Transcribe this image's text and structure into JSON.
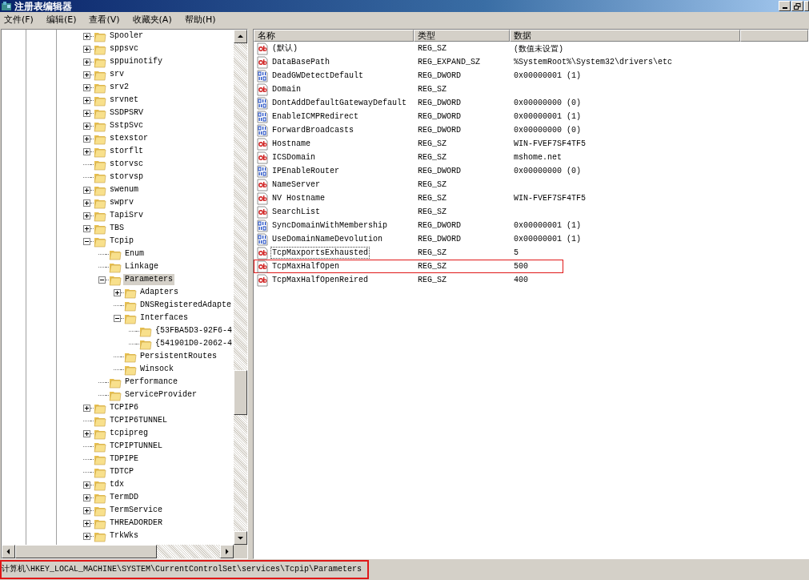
{
  "window": {
    "title": "注册表编辑器"
  },
  "menu": [
    "文件(F)",
    "编辑(E)",
    "查看(V)",
    "收藏夹(A)",
    "帮助(H)"
  ],
  "tree": [
    {
      "label": "Spooler",
      "expandable": true,
      "expanded": false,
      "selected": false
    },
    {
      "label": "sppsvc",
      "expandable": true,
      "expanded": false,
      "selected": false
    },
    {
      "label": "sppuinotify",
      "expandable": true,
      "expanded": false,
      "selected": false
    },
    {
      "label": "srv",
      "expandable": true,
      "expanded": false,
      "selected": false
    },
    {
      "label": "srv2",
      "expandable": true,
      "expanded": false,
      "selected": false
    },
    {
      "label": "srvnet",
      "expandable": true,
      "expanded": false,
      "selected": false
    },
    {
      "label": "SSDPSRV",
      "expandable": true,
      "expanded": false,
      "selected": false
    },
    {
      "label": "SstpSvc",
      "expandable": true,
      "expanded": false,
      "selected": false
    },
    {
      "label": "stexstor",
      "expandable": true,
      "expanded": false,
      "selected": false
    },
    {
      "label": "storflt",
      "expandable": true,
      "expanded": false,
      "selected": false
    },
    {
      "label": "storvsc",
      "expandable": false,
      "selected": false
    },
    {
      "label": "storvsp",
      "expandable": false,
      "selected": false
    },
    {
      "label": "swenum",
      "expandable": true,
      "expanded": false,
      "selected": false
    },
    {
      "label": "swprv",
      "expandable": true,
      "expanded": false,
      "selected": false
    },
    {
      "label": "TapiSrv",
      "expandable": true,
      "expanded": false,
      "selected": false
    },
    {
      "label": "TBS",
      "expandable": true,
      "expanded": false,
      "selected": false
    },
    {
      "label": "Tcpip",
      "expandable": true,
      "expanded": true,
      "selected": false,
      "children": [
        {
          "label": "Enum",
          "expandable": false,
          "selected": false
        },
        {
          "label": "Linkage",
          "expandable": false,
          "selected": false
        },
        {
          "label": "Parameters",
          "expandable": true,
          "expanded": true,
          "selected": true,
          "children": [
            {
              "label": "Adapters",
              "expandable": true,
              "expanded": false,
              "selected": false
            },
            {
              "label": "DNSRegisteredAdapte",
              "expandable": false,
              "selected": false
            },
            {
              "label": "Interfaces",
              "expandable": true,
              "expanded": true,
              "selected": false,
              "children": [
                {
                  "label": "{53FBA5D3-92F6-4",
                  "expandable": false,
                  "selected": false
                },
                {
                  "label": "{541901D0-2062-4",
                  "expandable": false,
                  "selected": false
                }
              ]
            },
            {
              "label": "PersistentRoutes",
              "expandable": false,
              "selected": false
            },
            {
              "label": "Winsock",
              "expandable": false,
              "selected": false
            }
          ]
        },
        {
          "label": "Performance",
          "expandable": false,
          "selected": false
        },
        {
          "label": "ServiceProvider",
          "expandable": false,
          "selected": false
        }
      ]
    },
    {
      "label": "TCPIP6",
      "expandable": true,
      "expanded": false,
      "selected": false
    },
    {
      "label": "TCPIP6TUNNEL",
      "expandable": false,
      "selected": false
    },
    {
      "label": "tcpipreg",
      "expandable": true,
      "expanded": false,
      "selected": false
    },
    {
      "label": "TCPIPTUNNEL",
      "expandable": false,
      "selected": false
    },
    {
      "label": "TDPIPE",
      "expandable": false,
      "selected": false
    },
    {
      "label": "TDTCP",
      "expandable": false,
      "selected": false
    },
    {
      "label": "tdx",
      "expandable": true,
      "expanded": false,
      "selected": false
    },
    {
      "label": "TermDD",
      "expandable": true,
      "expanded": false,
      "selected": false
    },
    {
      "label": "TermService",
      "expandable": true,
      "expanded": false,
      "selected": false
    },
    {
      "label": "THREADORDER",
      "expandable": true,
      "expanded": false,
      "selected": false
    },
    {
      "label": "TrkWks",
      "expandable": true,
      "expanded": false,
      "selected": false
    }
  ],
  "table": {
    "columns": [
      "名称",
      "类型",
      "数据"
    ],
    "rows": [
      {
        "kind": "string",
        "name": "(默认)",
        "type": "REG_SZ",
        "data": "(数值未设置)",
        "focused": false,
        "highlighted": false
      },
      {
        "kind": "string",
        "name": "DataBasePath",
        "type": "REG_EXPAND_SZ",
        "data": "%SystemRoot%\\System32\\drivers\\etc",
        "focused": false,
        "highlighted": false
      },
      {
        "kind": "binary",
        "name": "DeadGWDetectDefault",
        "type": "REG_DWORD",
        "data": "0x00000001 (1)",
        "focused": false,
        "highlighted": false
      },
      {
        "kind": "string",
        "name": "Domain",
        "type": "REG_SZ",
        "focused": false,
        "highlighted": false
      },
      {
        "kind": "binary",
        "name": "DontAddDefaultGatewayDefault",
        "type": "REG_DWORD",
        "data": "0x00000000 (0)",
        "focused": false,
        "highlighted": false
      },
      {
        "kind": "binary",
        "name": "EnableICMPRedirect",
        "type": "REG_DWORD",
        "data": "0x00000001 (1)",
        "focused": false,
        "highlighted": false
      },
      {
        "kind": "binary",
        "name": "ForwardBroadcasts",
        "type": "REG_DWORD",
        "data": "0x00000000 (0)",
        "focused": false,
        "highlighted": false
      },
      {
        "kind": "string",
        "name": "Hostname",
        "type": "REG_SZ",
        "data": "WIN-FVEF7SF4TF5",
        "focused": false,
        "highlighted": false
      },
      {
        "kind": "string",
        "name": "ICSDomain",
        "type": "REG_SZ",
        "data": "mshome.net",
        "focused": false,
        "highlighted": false
      },
      {
        "kind": "binary",
        "name": "IPEnableRouter",
        "type": "REG_DWORD",
        "data": "0x00000000 (0)",
        "focused": false,
        "highlighted": false
      },
      {
        "kind": "string",
        "name": "NameServer",
        "type": "REG_SZ",
        "focused": false,
        "highlighted": false
      },
      {
        "kind": "string",
        "name": "NV Hostname",
        "type": "REG_SZ",
        "data": "WIN-FVEF7SF4TF5",
        "focused": false,
        "highlighted": false
      },
      {
        "kind": "string",
        "name": "SearchList",
        "type": "REG_SZ",
        "focused": false,
        "highlighted": false
      },
      {
        "kind": "binary",
        "name": "SyncDomainWithMembership",
        "type": "REG_DWORD",
        "data": "0x00000001 (1)",
        "focused": false,
        "highlighted": false
      },
      {
        "kind": "binary",
        "name": "UseDomainNameDevolution",
        "type": "REG_DWORD",
        "data": "0x00000001 (1)",
        "focused": false,
        "highlighted": false
      },
      {
        "kind": "string",
        "name": "TcpMaxportsExhausted",
        "type": "REG_SZ",
        "data": "5",
        "focused": true,
        "highlighted": false
      },
      {
        "kind": "string",
        "name": "TcpMaxHalfOpen",
        "type": "REG_SZ",
        "data": "500",
        "focused": false,
        "highlighted": true
      },
      {
        "kind": "string",
        "name": "TcpMaxHalfOpenReired",
        "type": "REG_SZ",
        "data": "400",
        "focused": false,
        "highlighted": false
      }
    ]
  },
  "status_bar": {
    "text": "计算机\\HKEY_LOCAL_MACHINE\\SYSTEM\\CurrentControlSet\\services\\Tcpip\\Parameters",
    "highlighted": true
  }
}
